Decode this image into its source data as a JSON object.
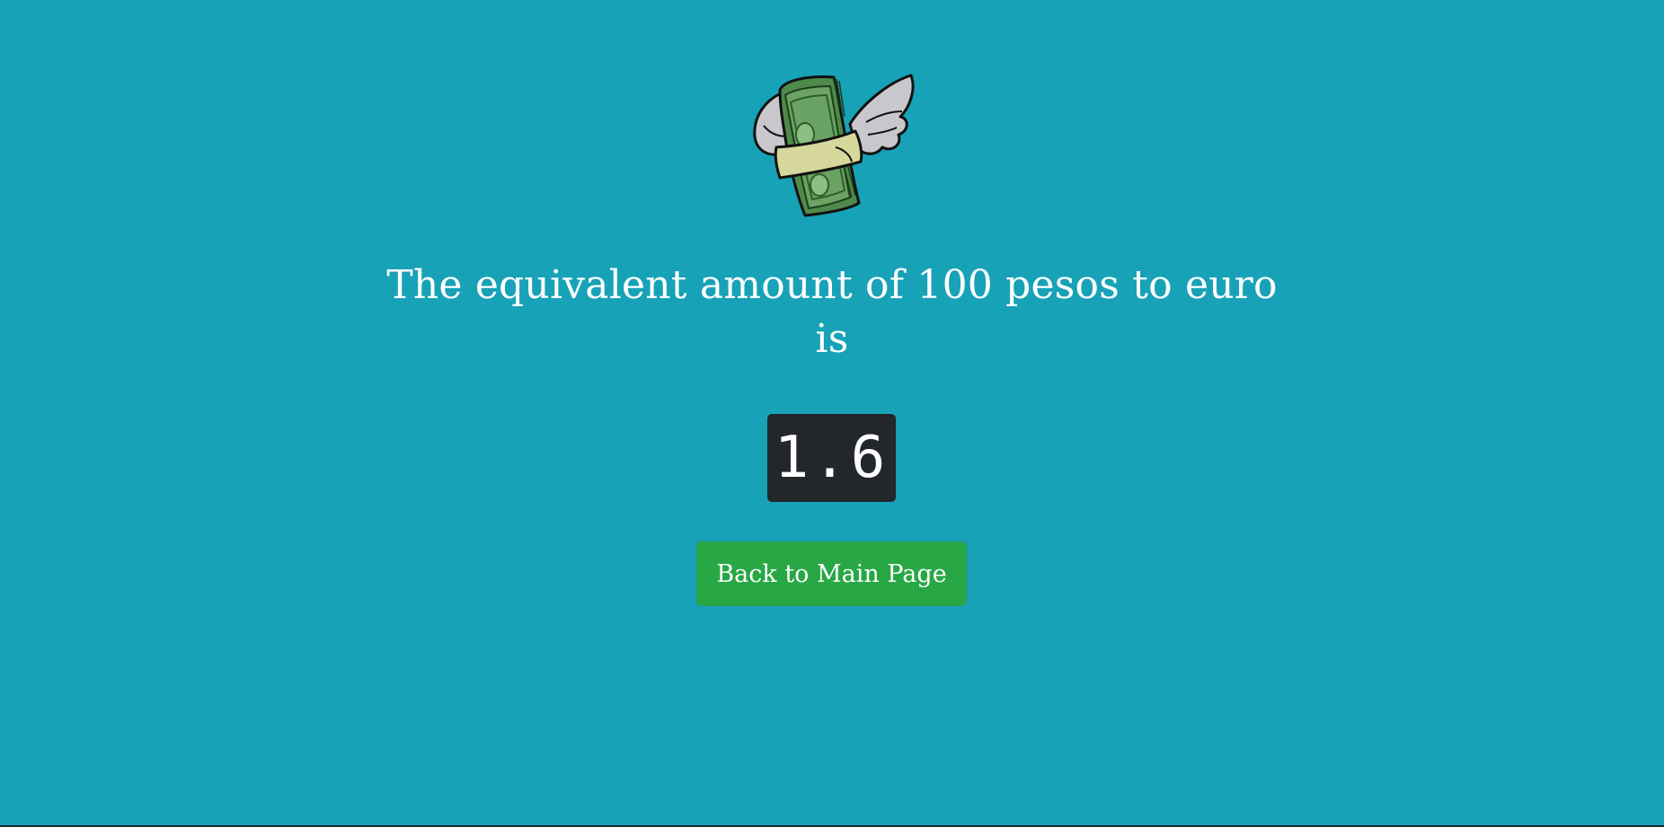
{
  "result": {
    "headline": "The equivalent amount of 100 pesos to euro is",
    "value": "1.6"
  },
  "actions": {
    "back_label": "Back to Main Page"
  },
  "logo": {
    "icon": "flying-money-icon"
  },
  "colors": {
    "background": "#17a2b8",
    "result_box": "#23272b",
    "button": "#28a745",
    "text": "#ffffff"
  }
}
